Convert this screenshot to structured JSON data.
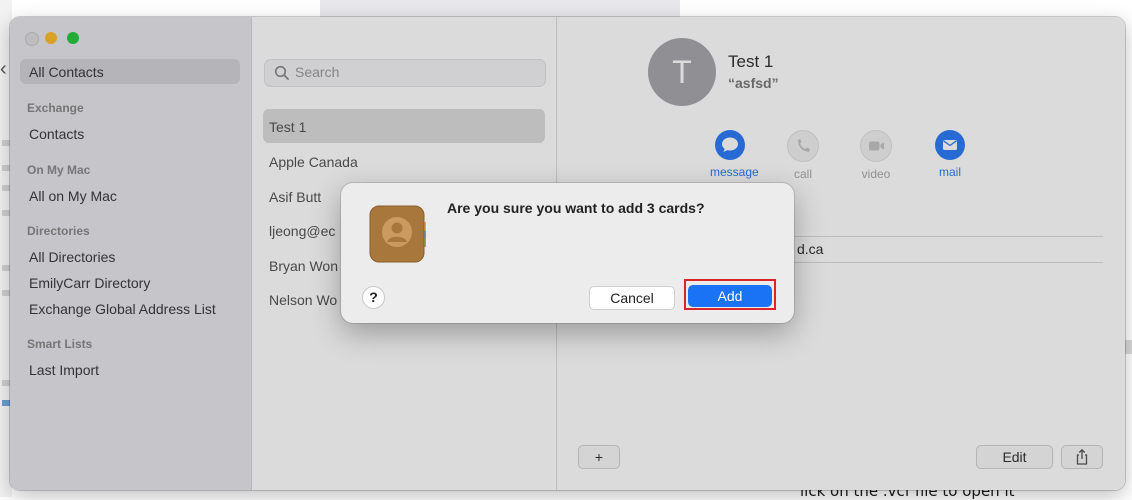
{
  "app": "Contacts",
  "background": {
    "caption": "lick on the .vcf file to open it"
  },
  "sidebar": {
    "selected": "All Contacts",
    "groups": [
      {
        "header": "Exchange",
        "items": [
          "Contacts"
        ]
      },
      {
        "header": "On My Mac",
        "items": [
          "All on My Mac"
        ]
      },
      {
        "header": "Directories",
        "items": [
          "All Directories",
          "EmilyCarr Directory",
          "Exchange Global Address List"
        ]
      },
      {
        "header": "Smart Lists",
        "items": [
          "Last Import"
        ]
      }
    ]
  },
  "list": {
    "search_placeholder": "Search",
    "items": [
      "Test 1",
      "Apple Canada",
      "Asif Butt",
      "ljeong@ec",
      "Bryan Won",
      "Nelson Wo"
    ],
    "selected_index": 0
  },
  "detail": {
    "avatar_initial": "T",
    "name": "Test 1",
    "nickname": "“asfsd”",
    "actions": [
      {
        "label": "message",
        "icon": "message-icon",
        "enabled": true
      },
      {
        "label": "call",
        "icon": "phone-icon",
        "enabled": false
      },
      {
        "label": "video",
        "icon": "video-icon",
        "enabled": false
      },
      {
        "label": "mail",
        "icon": "mail-icon",
        "enabled": true
      }
    ],
    "email_fragment": "d.ca",
    "footer": {
      "add_label": "+",
      "edit_label": "Edit"
    }
  },
  "alert": {
    "message": "Are you sure you want to add 3 cards?",
    "help_label": "?",
    "cancel_label": "Cancel",
    "add_label": "Add",
    "icon": "contacts-app-icon",
    "highlight_color": "#d9262a"
  },
  "colors": {
    "accent": "#1a72f5",
    "traffic_min": "#febc2e",
    "traffic_zoom": "#28c840"
  }
}
